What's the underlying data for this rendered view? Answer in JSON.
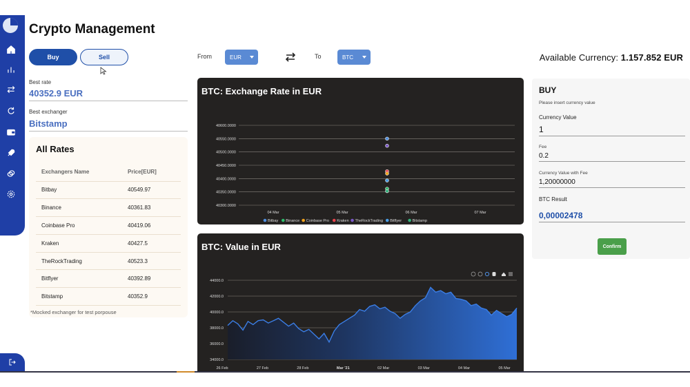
{
  "page": {
    "title": "Crypto Management"
  },
  "actions": {
    "buy_label": "Buy",
    "sell_label": "Sell"
  },
  "best": {
    "rate_label": "Best rate",
    "rate_value": "40352.9 EUR",
    "exchanger_label": "Best exchanger",
    "exchanger_value": "Bitstamp"
  },
  "rates": {
    "title": "All Rates",
    "columns": [
      "Exchangers Name",
      "Price[EUR]"
    ],
    "rows": [
      {
        "name": "Bitbay",
        "price": "40549.97"
      },
      {
        "name": "Binance",
        "price": "40361.83"
      },
      {
        "name": "Coinbase Pro",
        "price": "40419.06"
      },
      {
        "name": "Kraken",
        "price": "40427.5"
      },
      {
        "name": "TheRockTrading",
        "price": "40523.3"
      },
      {
        "name": "Bitflyer",
        "price": "40392.89"
      },
      {
        "name": "Bitstamp",
        "price": "40352.9"
      }
    ],
    "footnote": "*Mocked exchanger for test porpouse"
  },
  "converter": {
    "from_label": "From",
    "from_value": "EUR",
    "to_label": "To",
    "to_value": "BTC"
  },
  "available": {
    "label": "Available Currency:",
    "value": "1.157.852 EUR"
  },
  "buy_panel": {
    "title": "BUY",
    "hint": "Please insert currency value",
    "currency_label": "Currency Value",
    "currency_value": "1",
    "fee_label": "Fee",
    "fee_value": "0.2",
    "with_fee_label": "Currency Value with Fee",
    "with_fee_value": "1,20000000",
    "result_label": "BTC Result",
    "result_value": "0,00002478",
    "confirm_label": "Confirm"
  },
  "icons": {
    "nav": [
      "home-icon",
      "bar-chart-icon",
      "swap-icon",
      "exchange-icon",
      "wallet-icon",
      "rocket-icon",
      "coins-icon",
      "gear-icon"
    ],
    "logout": "logout-icon"
  },
  "colors": {
    "primary": "#1f4fa8",
    "sidebar": "#1f3fa6",
    "confirm": "#4a9f4a",
    "chart_bg": "#242221",
    "area": "#2f6fd6"
  },
  "chart_data": [
    {
      "type": "scatter",
      "title": "BTC: Exchange Rate in EUR",
      "x_ticks": [
        "04 Mar",
        "05 Mar",
        "06 Mar",
        "07 Mar"
      ],
      "y_ticks": [
        "40300.0000",
        "40350.0000",
        "40400.0000",
        "40450.0000",
        "40500.0000",
        "40550.0000",
        "40600.0000"
      ],
      "ylim": [
        40300,
        40600
      ],
      "xlim": [
        0,
        4
      ],
      "grid": true,
      "legend": "bottom",
      "series": [
        {
          "name": "Bitbay",
          "color": "#4f8fe0",
          "x": 2.15,
          "y": 40549.97
        },
        {
          "name": "Binance",
          "color": "#2ebd6b",
          "x": 2.15,
          "y": 40361.83
        },
        {
          "name": "Coinbase Pro",
          "color": "#f0a21c",
          "x": 2.15,
          "y": 40419.06
        },
        {
          "name": "Kraken",
          "color": "#e8434c",
          "x": 2.15,
          "y": 40427.5
        },
        {
          "name": "TheRockTrading",
          "color": "#7a58c8",
          "x": 2.15,
          "y": 40523.3
        },
        {
          "name": "Bitflyer",
          "color": "#4a9ee6",
          "x": 2.15,
          "y": 40392.89
        },
        {
          "name": "Bitstamp",
          "color": "#34b07c",
          "x": 2.15,
          "y": 40352.9
        }
      ]
    },
    {
      "type": "area",
      "title": "BTC: Value in EUR",
      "x_ticks": [
        "26 Feb",
        "27 Feb",
        "28 Feb",
        "Mar '21",
        "02 Mar",
        "03 Mar",
        "04 Mar",
        "05 Mar"
      ],
      "y_ticks": [
        "34000.0",
        "36000.0",
        "38000.0",
        "40000.0",
        "42000.0",
        "44000.0"
      ],
      "ylim": [
        34000,
        44000
      ],
      "grid": true,
      "values": [
        38300,
        38900,
        38500,
        37700,
        38800,
        38400,
        38900,
        39000,
        38600,
        38900,
        39200,
        38700,
        38200,
        38600,
        37900,
        37500,
        37800,
        37200,
        36600,
        37300,
        36200,
        37600,
        38400,
        38800,
        39200,
        39600,
        40300,
        40100,
        40700,
        40900,
        40400,
        40600,
        40100,
        39800,
        39200,
        39700,
        40000,
        40800,
        41400,
        41800,
        43100,
        42500,
        42700,
        42300,
        42500,
        41700,
        41600,
        41400,
        40800,
        41000,
        40500,
        40300,
        39600,
        40200,
        39800,
        39400,
        39700,
        40500
      ]
    }
  ]
}
